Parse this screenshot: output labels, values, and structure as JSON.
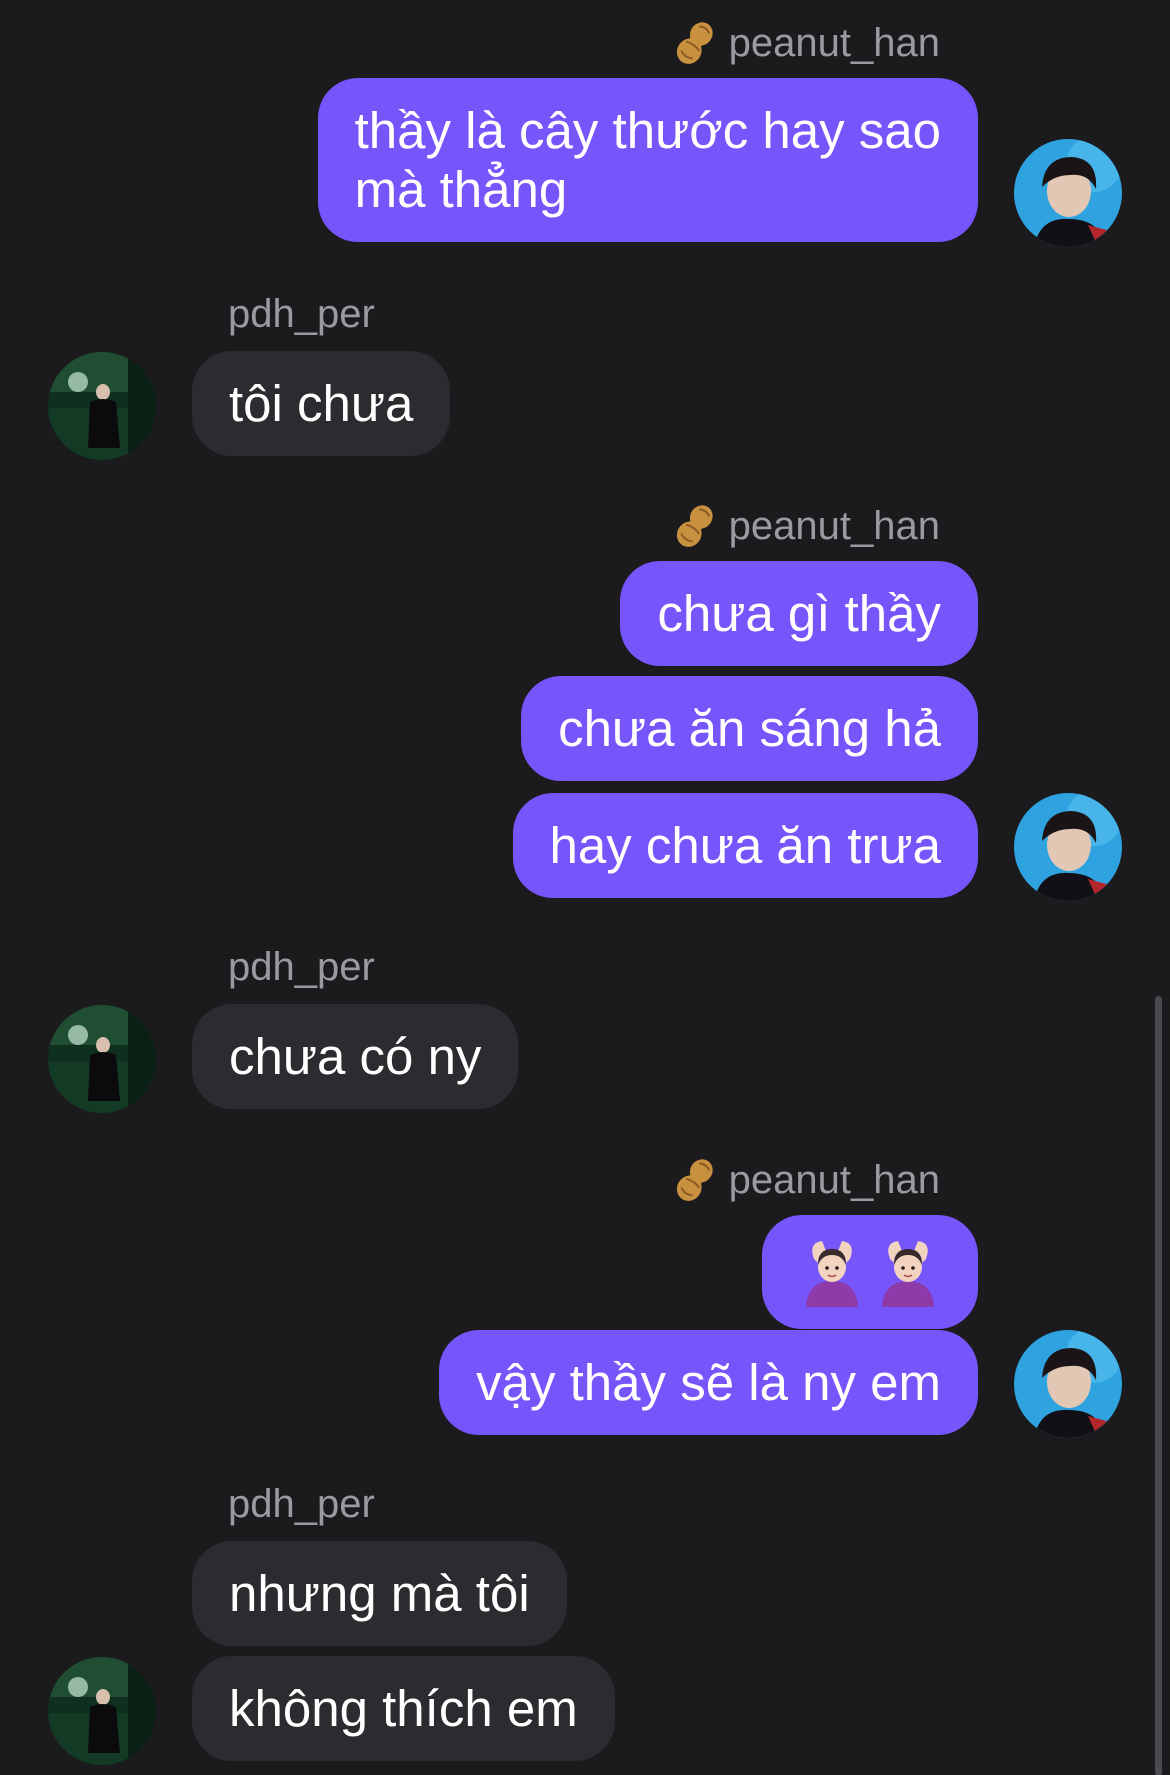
{
  "users": {
    "me": {
      "name": "peanut_han",
      "badge_icon": "peanut-icon"
    },
    "them": {
      "name": "pdh_per"
    }
  },
  "colors": {
    "background": "#1b1b1e",
    "outgoing_bubble": "#7655fa",
    "incoming_bubble": "#2c2c30",
    "sender_text": "#9a9aa0"
  },
  "messages": [
    {
      "id": "m1",
      "from": "peanut_han",
      "text": "thầy là cây thước hay sao\nmà thẳng"
    },
    {
      "id": "m2",
      "from": "pdh_per",
      "text": "tôi chưa"
    },
    {
      "id": "m3",
      "from": "peanut_han",
      "text": "chưa gì thầy"
    },
    {
      "id": "m4",
      "from": "peanut_han",
      "text": "chưa ăn sáng hả"
    },
    {
      "id": "m5",
      "from": "peanut_han",
      "text": "hay chưa ăn trưa"
    },
    {
      "id": "m6",
      "from": "pdh_per",
      "text": "chưa có ny"
    },
    {
      "id": "m7",
      "from": "peanut_han",
      "emoji": "🙆🏻‍♀️🙆🏻‍♀️"
    },
    {
      "id": "m8",
      "from": "peanut_han",
      "text": "vậy thầy sẽ là ny em"
    },
    {
      "id": "m9",
      "from": "pdh_per",
      "text": "nhưng mà tôi"
    },
    {
      "id": "m10",
      "from": "pdh_per",
      "text": "không thích em"
    }
  ]
}
